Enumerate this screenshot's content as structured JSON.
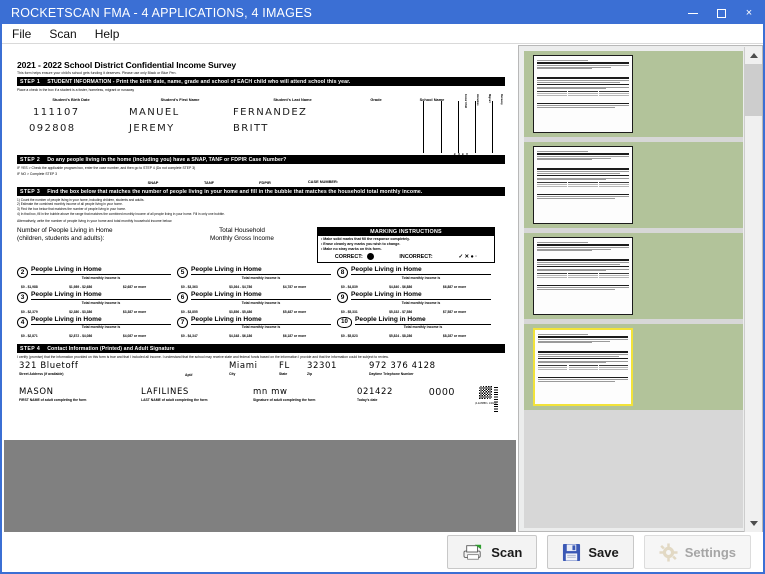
{
  "window": {
    "title": "ROCKETSCAN FMA - 4 APPLICATIONS, 4 IMAGES",
    "minimize_label": "Minimize",
    "maximize_label": "Maximize",
    "close_label": "×"
  },
  "menu": {
    "items": [
      {
        "label": "File"
      },
      {
        "label": "Scan"
      },
      {
        "label": "Help"
      }
    ]
  },
  "document": {
    "title": "2021 - 2022 School District Confidential Income Survey",
    "subtitle": "This form helps ensure your child's school gets funding it deserves. Please use only Black or Blue Pen.",
    "step1": {
      "num": "STEP 1",
      "text": "STUDENT INFORMATION - Print the birth date, name, grade and school of EACH child who will attend school this year.",
      "note": "Place a check in the box if a student is a foster, homeless, migrant or runaway",
      "columns": [
        "Student's Birth Date",
        "Student's First Name",
        "Student's Last Name",
        "Grade",
        "School Name"
      ],
      "vertical_columns": [
        "Foster Child",
        "Homeless",
        "Migrant",
        "Runaway"
      ],
      "check_all": "Check all that apply",
      "rows": [
        {
          "birth_date": "111107",
          "first_name": "MANUEL",
          "last_name": "FERNANDEZ",
          "grade": "",
          "school": ""
        },
        {
          "birth_date": "092808",
          "first_name": "JEREMY",
          "last_name": "BRITT",
          "grade": "",
          "school": ""
        }
      ]
    },
    "step2": {
      "num": "STEP 2",
      "text": "Do any people living in the home (including you) have a SNAP, TANF or FDPIR Case Number?",
      "if_yes": "IF YES > Check the applicable program box, enter the case number, and then go to STEP 4 (Do not complete STEP 3)",
      "if_no": "IF NO > Complete STEP 3",
      "program_labels": [
        "SNAP",
        "TANF",
        "FDPIR"
      ],
      "case_number_label": "CASE NUMBER:"
    },
    "step3": {
      "num": "STEP 3",
      "text": "Find the box below that matches the number of people living in your home and fill in the bubble that matches the household total monthly income.",
      "instructions": [
        "1) Count the number of people living in your home, including children, students and adults.",
        "2) Estimate the combined monthly income of all people living in your home.",
        "3) Find the box below that matches the number of people living in your home.",
        "4) In that box, fill in the bubble above the range that matches the combined monthly income of all people living in your home. Fill in only one bubble."
      ],
      "alt_note": "Alternatively, write the number of people living in your home and total monthly household income below.",
      "left_label_1": "Number of People Living in Home",
      "left_label_2": "(children, students and adults):",
      "right_label_1": "Total Household",
      "right_label_2": "Monthly Gross Income",
      "marking": {
        "title": "MARKING INSTRUCTIONS",
        "bullets": [
          "• Make solid marks that fill the response completely.",
          "• Erase cleanly any marks you wish to change.",
          "• Make no stray marks on this form."
        ],
        "correct_label": "CORRECT:",
        "incorrect_label": "INCORRECT:",
        "incorrect_glyphs": "✓ ✕ ● ·"
      },
      "household_boxes": [
        {
          "n": "2",
          "title": "People Living in Home",
          "sub": "Total monthly income is",
          "ranges": [
            "$0 - $1,988",
            "$1,989 - $2,686",
            "$2,687 or more"
          ]
        },
        {
          "n": "3",
          "title": "People Living in Home",
          "sub": "Total monthly income is",
          "ranges": [
            "$0 - $2,379",
            "$2,380 - $3,386",
            "$3,387 or more"
          ]
        },
        {
          "n": "4",
          "title": "People Living in Home",
          "sub": "Total monthly income is",
          "ranges": [
            "$0 - $2,871",
            "$2,872 - $4,086",
            "$4,087 or more"
          ]
        },
        {
          "n": "5",
          "title": "People Living in Home",
          "sub": "Total monthly income is",
          "ranges": [
            "$0 - $3,363",
            "$3,364 - $4,786",
            "$4,787 or more"
          ]
        },
        {
          "n": "6",
          "title": "People Living in Home",
          "sub": "Total monthly income is",
          "ranges": [
            "$0 - $3,855",
            "$3,856 - $5,486",
            "$5,487 or more"
          ]
        },
        {
          "n": "7",
          "title": "People Living in Home",
          "sub": "Total monthly income is",
          "ranges": [
            "$0 - $4,347",
            "$4,348 - $6,186",
            "$6,187 or more"
          ]
        },
        {
          "n": "8",
          "title": "People Living in Home",
          "sub": "Total monthly income is",
          "ranges": [
            "$0 - $4,839",
            "$4,840 - $6,886",
            "$6,887 or more"
          ]
        },
        {
          "n": "9",
          "title": "People Living in Home",
          "sub": "Total monthly income is",
          "ranges": [
            "$0 - $5,331",
            "$5,332 - $7,586",
            "$7,587 or more"
          ]
        },
        {
          "n": "10",
          "title": "People Living in Home",
          "sub": "Total monthly income is",
          "ranges": [
            "$0 - $5,823",
            "$5,824 - $8,286",
            "$8,287 or more"
          ]
        }
      ]
    },
    "step4": {
      "num": "STEP 4",
      "text": "Contact Information (Printed) and Adult Signature",
      "certify": "I certify (promise) that the information provided on this form is true and that I included all income. I understand that the school may receive state and federal funds based on the information I provide and that the information could be subject to review.",
      "labels": {
        "street": "Street Address (if available)",
        "apt": "Apt#",
        "city": "City",
        "state": "State",
        "zip": "Zip",
        "phone": "Daytime Telephone Number",
        "first_name": "FIRST NAME of adult completing the form",
        "last_name": "LAST NAME of adult completing the form",
        "signature": "Signature of adult completing the form",
        "date": "Today's date"
      },
      "values": {
        "street": "321 Bluetoff",
        "apt": "",
        "city": "Miami",
        "state": "FL",
        "zip": "32301",
        "phone": "972 376 4128",
        "first_name": "MASON",
        "last_name": "LAFILINES",
        "signature": "mn mw",
        "date": "021422",
        "form_id": "0000",
        "barcode_caption": "(4-22/8888 • 1/2021)"
      }
    }
  },
  "thumbnails": {
    "count": 4,
    "items": [
      {
        "index": "1",
        "selected": false
      },
      {
        "index": "2",
        "selected": false
      },
      {
        "index": "3",
        "selected": false
      },
      {
        "index": "4",
        "selected": true
      }
    ],
    "background_color": "#b2c39a",
    "selection_color": "#f2e33a"
  },
  "scrollbar": {
    "up_label": "Scroll up",
    "down_label": "Scroll down"
  },
  "toolbar": {
    "scan_label": "Scan",
    "save_label": "Save",
    "settings_label": "Settings",
    "settings_disabled": true
  },
  "colors": {
    "title_bar": "#3b6fd4",
    "viewer_background": "#808080",
    "thumb_panel": "#eceded"
  }
}
